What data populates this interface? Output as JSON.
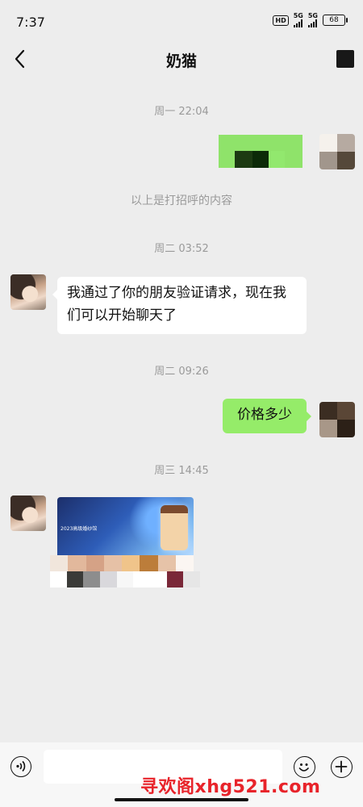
{
  "status_bar": {
    "time": "7:37",
    "network_badge": "HD",
    "signal_1_label": "5G",
    "signal_2_label": "5G",
    "battery_level": "68"
  },
  "header": {
    "title": "奶猫"
  },
  "messages": {
    "ts_1": "周一 22:04",
    "greeting_note": "以上是打招呼的内容",
    "ts_2": "周二 03:52",
    "friend_verified": "我通过了你的朋友验证请求，现在我们可以开始聊天了",
    "ts_3": "周二 09:26",
    "price_question": "价格多少",
    "ts_4": "周三 14:45",
    "card_caption": "2023高级婚纱馆"
  },
  "input": {
    "placeholder": ""
  },
  "watermark": "寻欢阁xhg521.com",
  "colors": {
    "background": "#ededed",
    "outgoing_bubble": "#95ec69",
    "incoming_bubble": "#ffffff",
    "timestamp": "#9a9a9a",
    "watermark": "#e8232a"
  }
}
